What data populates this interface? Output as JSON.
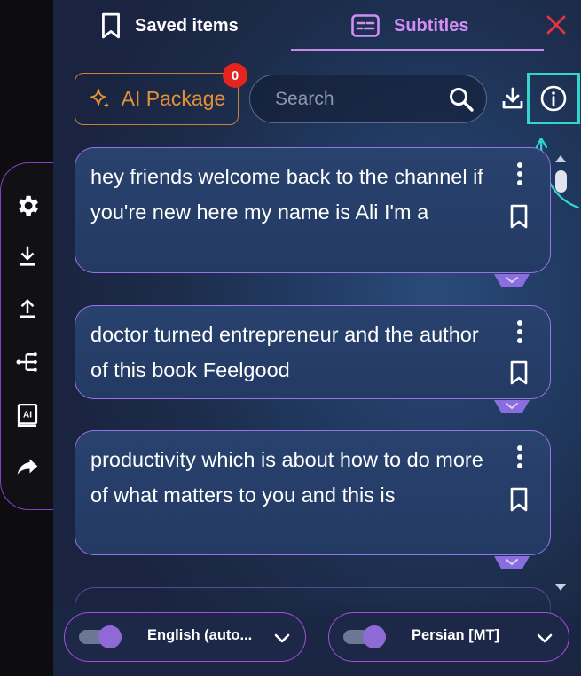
{
  "tabs": {
    "saved_label": "Saved items",
    "subtitles_label": "Subtitles",
    "active": "Subtitles"
  },
  "toolbar": {
    "ai_package_label": "AI Package",
    "ai_package_badge": "0",
    "search_placeholder": "Search"
  },
  "left_toolbar": {
    "icons": [
      "gear-icon",
      "download-icon",
      "upload-icon",
      "tree-icon",
      "ai-book-icon",
      "share-icon"
    ]
  },
  "subtitles": [
    {
      "text": "hey friends welcome back to the channel if you're new here my name is Ali I'm a"
    },
    {
      "text": "doctor turned entrepreneur and the author of this book Feelgood"
    },
    {
      "text": "productivity which is about how to do more of what matters to you and this is"
    }
  ],
  "footer": {
    "source_language": "English (auto...",
    "target_language": "Persian [MT]",
    "source_toggle_on": true,
    "target_toggle_on": true
  },
  "colors": {
    "accent_purple": "#c48be8",
    "ai_orange": "#e39039",
    "badge_red": "#e4241f",
    "info_highlight": "#33d6cf",
    "close_red": "#e8323f"
  }
}
